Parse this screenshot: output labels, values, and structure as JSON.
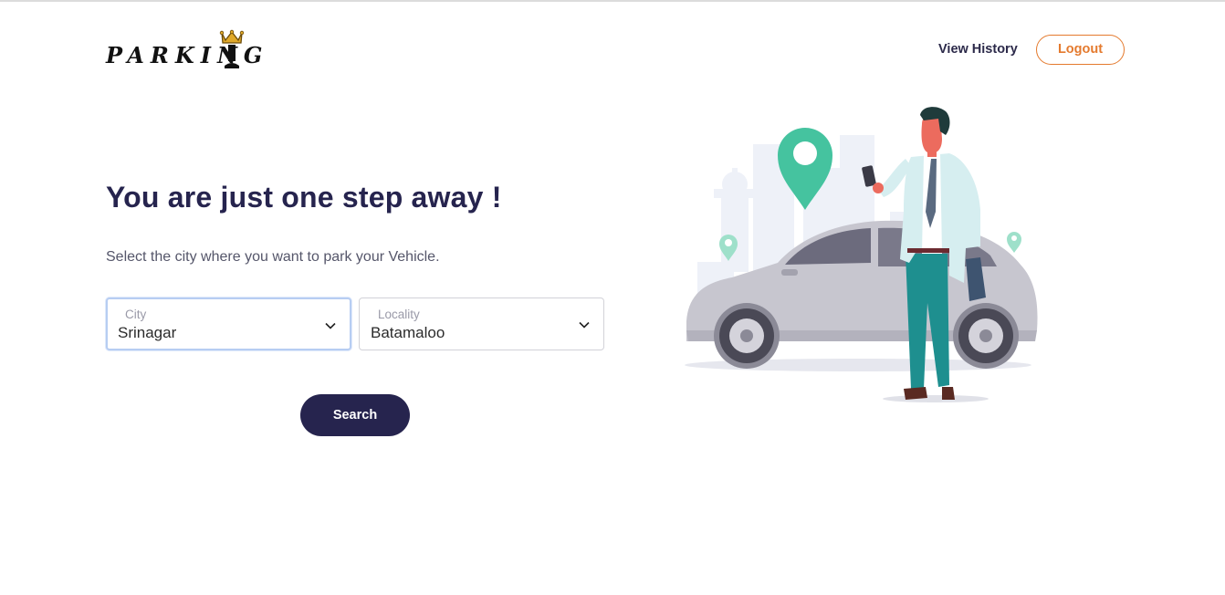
{
  "header": {
    "logo_text": "PARKING",
    "nav_view_history": "View History",
    "logout_label": "Logout"
  },
  "main": {
    "headline": "You are just one step away !",
    "subtitle": "Select the city where you want to park your Vehicle.",
    "city_select": {
      "label": "City",
      "value": "Srinagar"
    },
    "locality_select": {
      "label": "Locality",
      "value": "Batamaloo"
    },
    "search_label": "Search"
  },
  "colors": {
    "primary": "#26244e",
    "accent": "#e47a2e",
    "pin": "#45c39f",
    "focus_border": "#b7cdf2"
  },
  "icons": [
    "crown-icon",
    "chevron-down-icon",
    "map-pin-icon"
  ]
}
